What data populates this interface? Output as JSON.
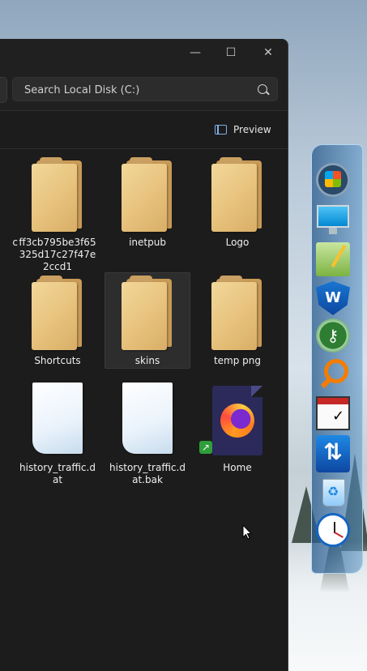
{
  "search": {
    "placeholder": "Search Local Disk (C:)"
  },
  "toolbar": {
    "preview_label": "Preview"
  },
  "window": {
    "minimize": "—",
    "maximize": "☐",
    "close": "✕"
  },
  "items": [
    {
      "label": "c",
      "type": "folder"
    },
    {
      "label": "ff3cb795be3f65325d17c27f47e2ccd1",
      "type": "folder"
    },
    {
      "label": "inetpub",
      "type": "folder"
    },
    {
      "label": "Logo",
      "type": "folder"
    },
    {
      "label": "Shortcuts",
      "type": "folder"
    },
    {
      "label": "skins",
      "type": "folder",
      "selected": true
    },
    {
      "label": "temp png",
      "type": "folder"
    },
    {
      "label": "history_traffic.dat",
      "type": "file"
    },
    {
      "label": "history_traffic.dat.bak",
      "type": "file"
    },
    {
      "label": "Home",
      "type": "firefox-shortcut"
    }
  ],
  "dock": {
    "icons": [
      "windows-start-icon",
      "monitor-icon",
      "notepad-icon",
      "shield-icon",
      "key-icon",
      "search-icon",
      "checklist-icon",
      "arrows-icon",
      "recycle-bin-icon",
      "clock-icon"
    ]
  },
  "colors": {
    "window_bg": "#1c1c1c",
    "accent": "#7fb0e6",
    "folder": "#e8c47f"
  }
}
